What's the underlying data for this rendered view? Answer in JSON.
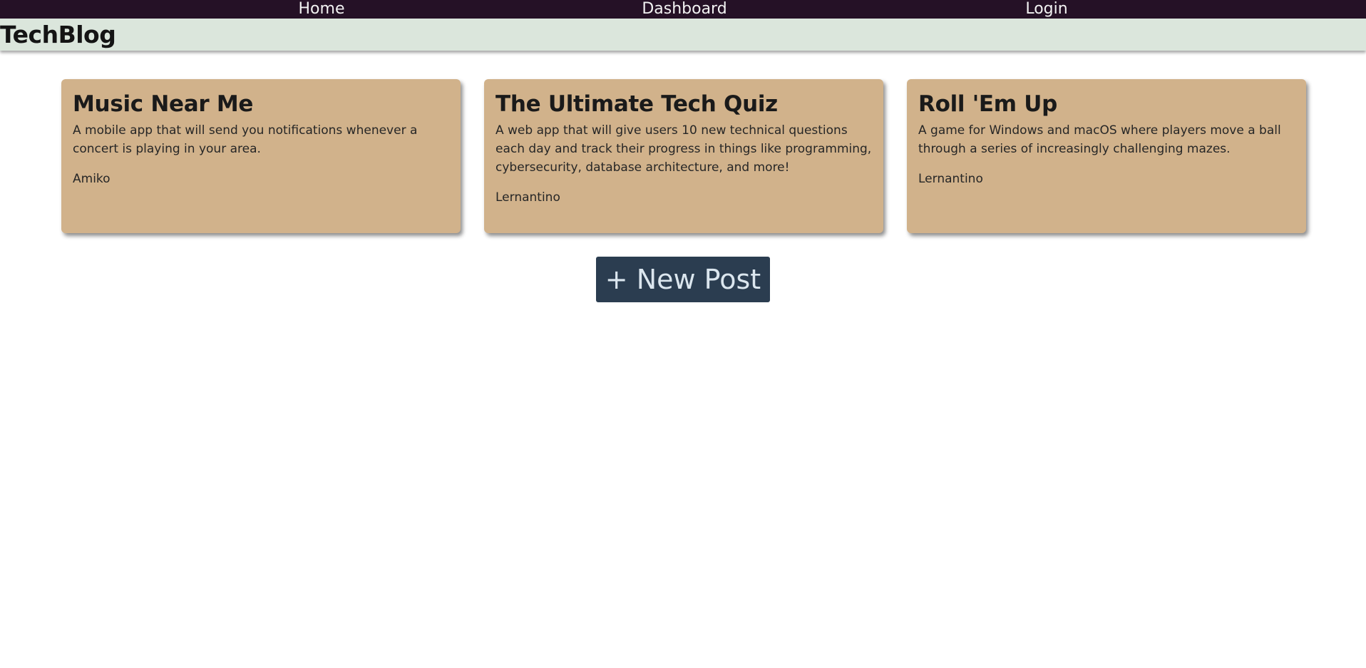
{
  "nav": {
    "items": [
      {
        "label": "Home"
      },
      {
        "label": "Dashboard"
      },
      {
        "label": "Login"
      }
    ]
  },
  "brand": {
    "title": "TechBlog"
  },
  "posts": [
    {
      "title": "Music Near Me",
      "description": "A mobile app that will send you notifications whenever a concert is playing in your area.",
      "author": "Amiko"
    },
    {
      "title": "The Ultimate Tech Quiz",
      "description": "A web app that will give users 10 new technical questions each day and track their progress in things like programming, cybersecurity, database architecture, and more!",
      "author": "Lernantino"
    },
    {
      "title": "Roll 'Em Up",
      "description": "A game for Windows and macOS where players move a ball through a series of increasingly challenging mazes.",
      "author": "Lernantino"
    }
  ],
  "actions": {
    "new_post_label": "+ New Post"
  },
  "colors": {
    "nav_bg": "#251126",
    "brand_bg": "#dbe6dc",
    "card_bg": "#d1b28b",
    "button_bg": "#2b3d50"
  }
}
